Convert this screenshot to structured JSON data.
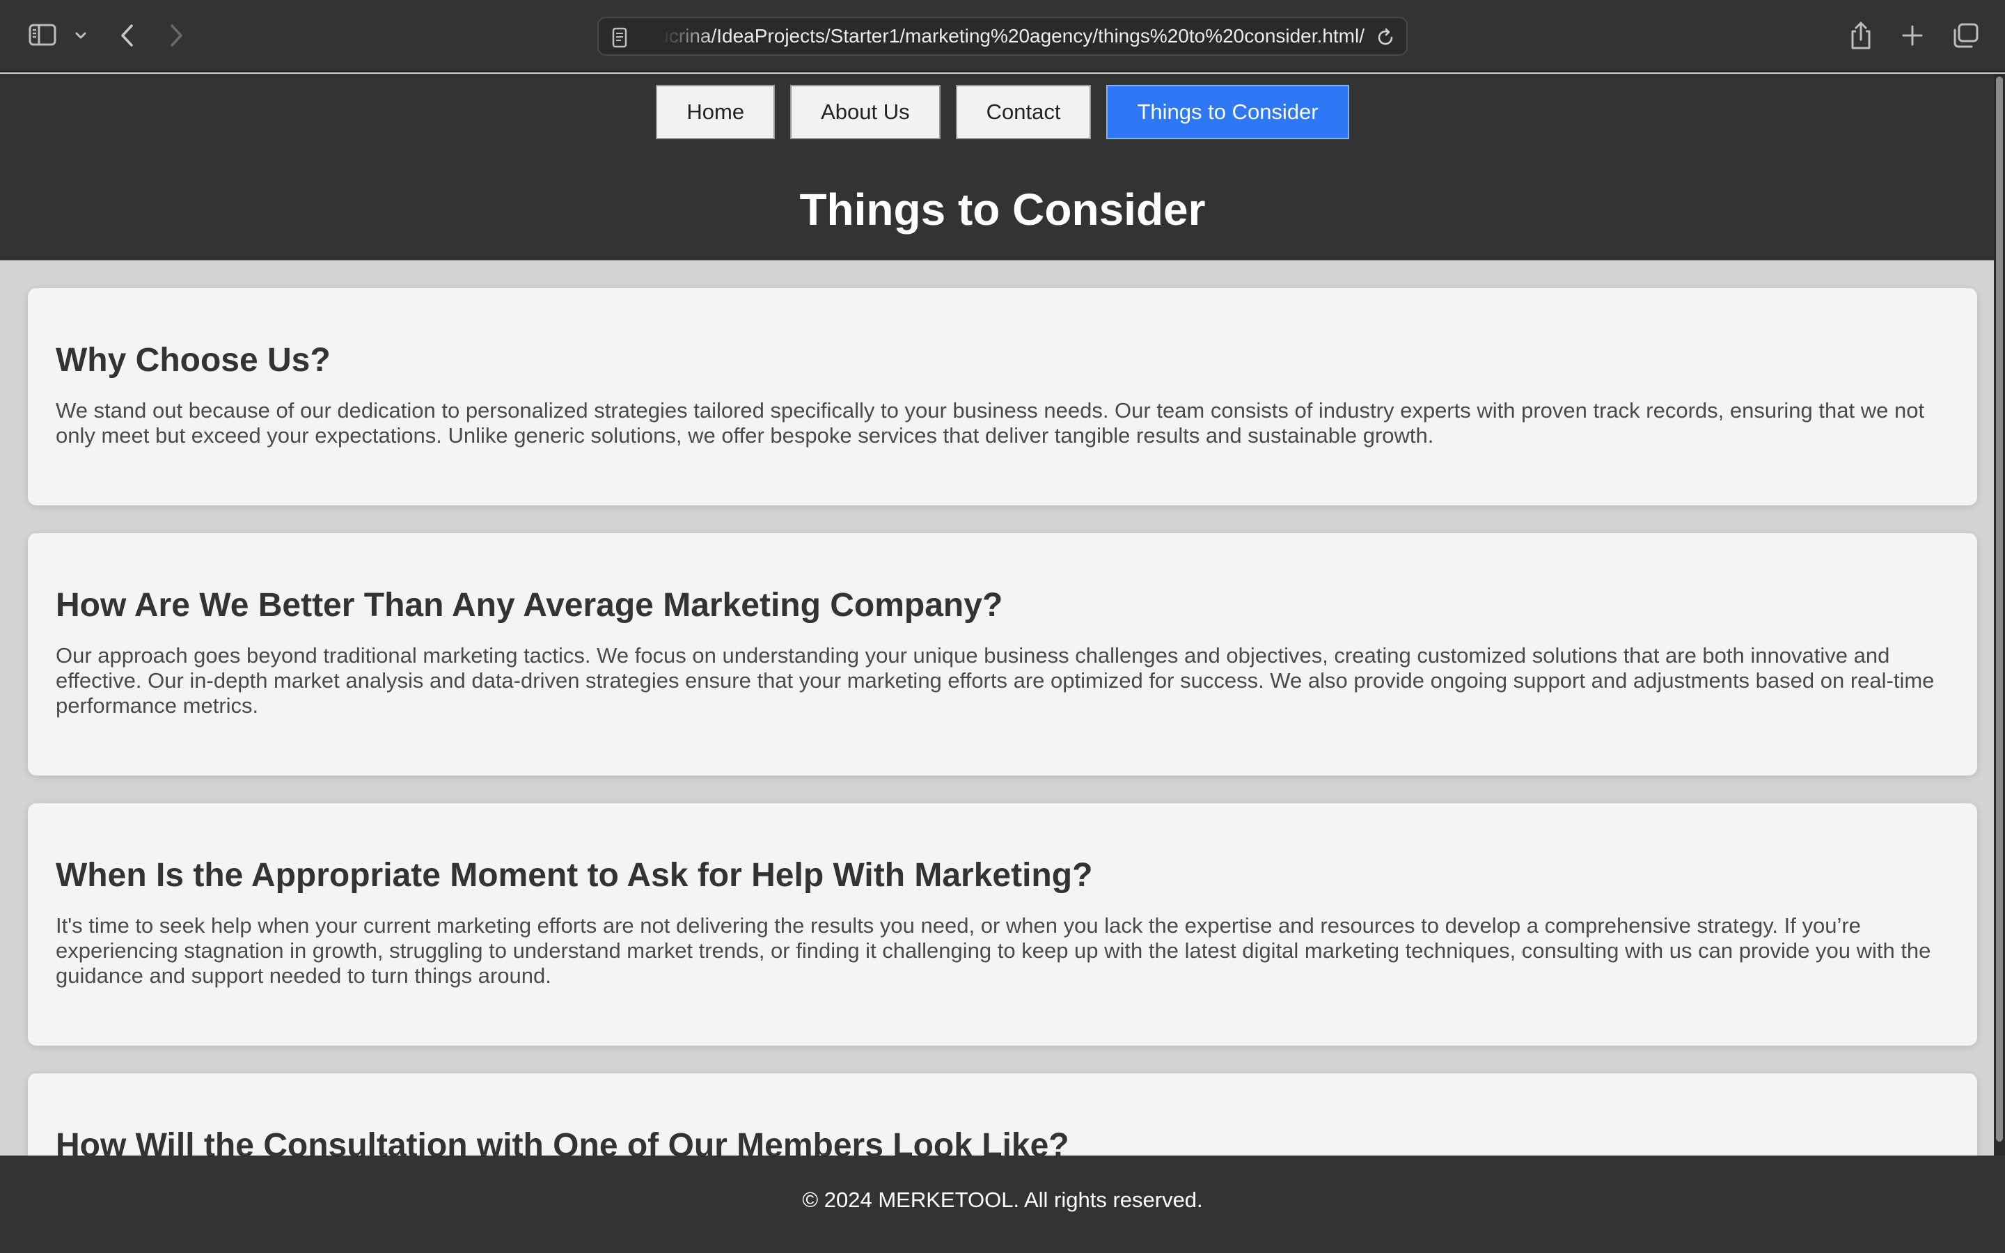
{
  "browser": {
    "url": "/Users/kucrina/IdeaProjects/Starter1/marketing%20agency/things%20to%20consider.html",
    "icons": {
      "sidebar": "sidebar-icon",
      "chevron": "chevron-down-icon",
      "back": "back-arrow-icon",
      "forward": "forward-arrow-icon",
      "page": "document-icon",
      "reload": "reload-icon",
      "share": "share-icon",
      "new_tab": "plus-icon",
      "tab_overview": "tabs-overview-icon"
    }
  },
  "nav": {
    "items": [
      {
        "label": "Home",
        "active": false
      },
      {
        "label": "About Us",
        "active": false
      },
      {
        "label": "Contact",
        "active": false
      },
      {
        "label": "Things to Consider",
        "active": true
      }
    ]
  },
  "header": {
    "title": "Things to Consider"
  },
  "sections": [
    {
      "heading": "Why Choose Us?",
      "body": "We stand out because of our dedication to personalized strategies tailored specifically to your business needs. Our team consists of industry experts with proven track records, ensuring that we not only meet but exceed your expectations. Unlike generic solutions, we offer bespoke services that deliver tangible results and sustainable growth."
    },
    {
      "heading": "How Are We Better Than Any Average Marketing Company?",
      "body": "Our approach goes beyond traditional marketing tactics. We focus on understanding your unique business challenges and objectives, creating customized solutions that are both innovative and effective. Our in-depth market analysis and data-driven strategies ensure that your marketing efforts are optimized for success. We also provide ongoing support and adjustments based on real-time performance metrics."
    },
    {
      "heading": "When Is the Appropriate Moment to Ask for Help With Marketing?",
      "body": "It's time to seek help when your current marketing efforts are not delivering the results you need, or when you lack the expertise and resources to develop a comprehensive strategy. If you’re experiencing stagnation in growth, struggling to understand market trends, or finding it challenging to keep up with the latest digital marketing techniques, consulting with us can provide you with the guidance and support needed to turn things around."
    },
    {
      "heading": "How Will the Consultation with One of Our Members Look Like?",
      "body": ""
    }
  ],
  "footer": {
    "text": "© 2024 MERKETOOL. All rights reserved."
  },
  "colors": {
    "header_bg": "#333333",
    "active_nav": "#2f78f5",
    "card_bg": "#f4f4f4",
    "page_bg": "#d3d3d3"
  }
}
